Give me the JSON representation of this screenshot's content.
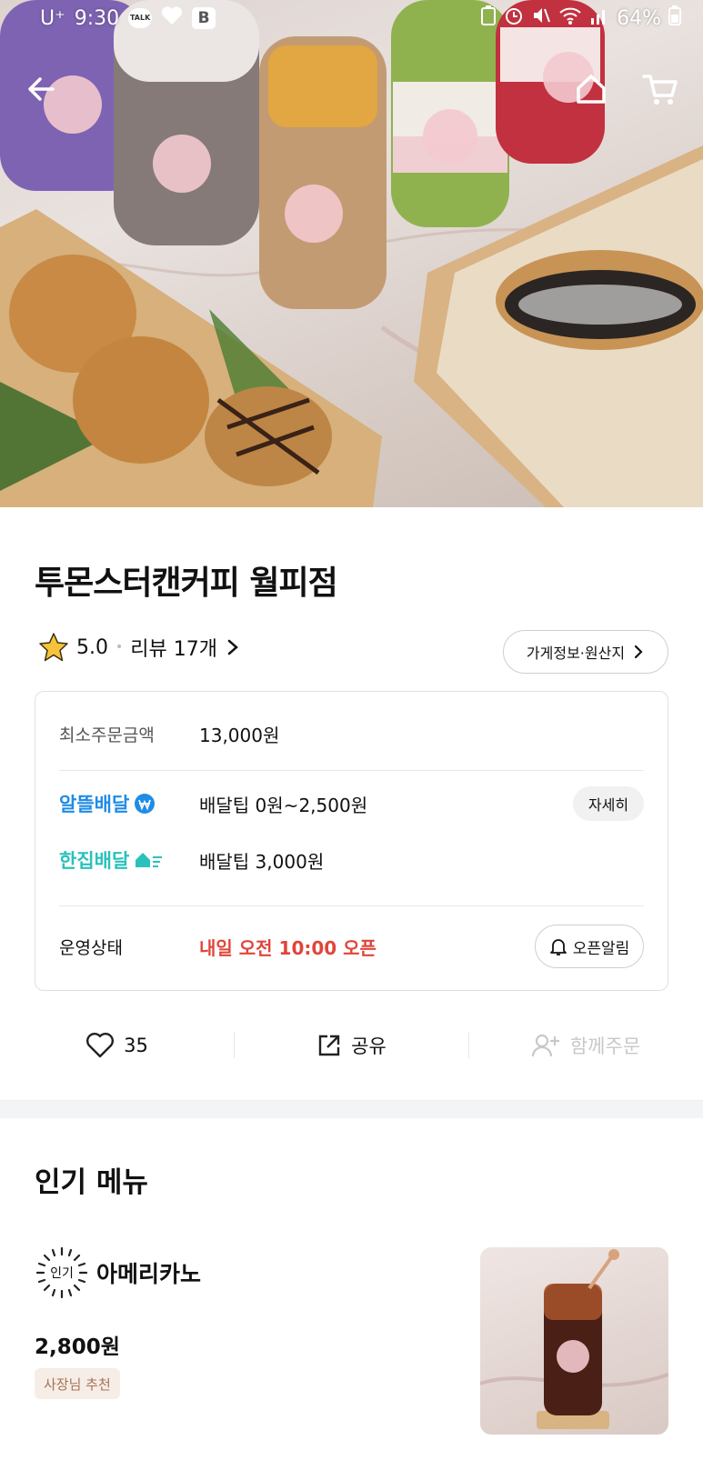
{
  "status_bar": {
    "carrier": "U⁺",
    "time": "9:30",
    "talk_badge": "TALK",
    "b_badge": "B",
    "battery": "64%"
  },
  "store": {
    "name": "투몬스터캔커피 월피점",
    "rating": "5.0",
    "reviews": "리뷰 17개",
    "info_button": "가게정보·원산지"
  },
  "info": {
    "min_order_label": "최소주문금액",
    "min_order_value": "13,000원",
    "delivery_1_label": "알뜰배달",
    "delivery_1_tip": "배달팁 0원~2,500원",
    "detail_button": "자세히",
    "delivery_2_label": "한집배달",
    "delivery_2_tip": "배달팁 3,000원",
    "status_label": "운영상태",
    "status_value": "내일 오전 10:00 오픈",
    "open_alarm_button": "오픈알림",
    "colors": {
      "delivery_1": "#1f8ce6",
      "delivery_2": "#2ac1bc",
      "status": "#e0453a"
    }
  },
  "actions": {
    "like_count": "35",
    "share": "공유",
    "group_order": "함께주문"
  },
  "popular": {
    "title": "인기 메뉴",
    "items": [
      {
        "badge": "인기",
        "name": "아메리카노",
        "price": "2,800원",
        "tag": "사장님 추천"
      }
    ]
  }
}
